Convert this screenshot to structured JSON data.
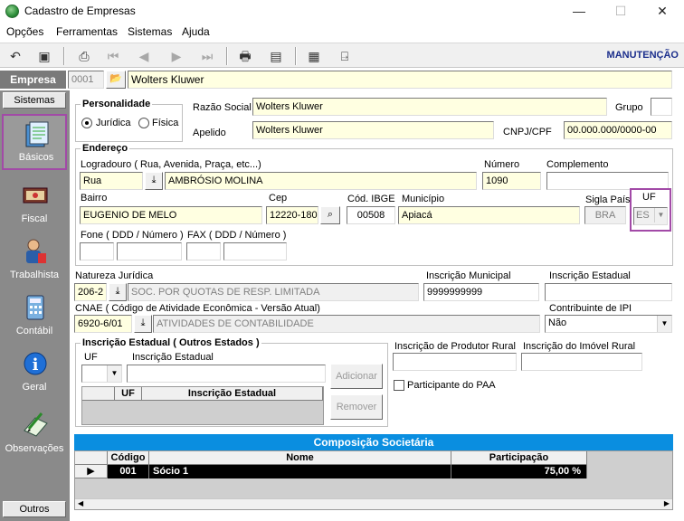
{
  "window": {
    "title": "Cadastro de Empresas",
    "minimize": "—",
    "maximize": "☐",
    "close": "✕"
  },
  "menu": [
    "Opções",
    "Ferramentas",
    "Sistemas",
    "Ajuda"
  ],
  "toolbar": {
    "mode": "MANUTENÇÃO"
  },
  "empresa": {
    "label": "Empresa",
    "code": "0001",
    "name": "Wolters Kluwer"
  },
  "sidebar": {
    "top_label": "Sistemas",
    "bottom_label": "Outros",
    "items": [
      {
        "label": "Básicos",
        "icon": "basicos-icon"
      },
      {
        "label": "Fiscal",
        "icon": "fiscal-icon"
      },
      {
        "label": "Trabalhista",
        "icon": "trabalhista-icon"
      },
      {
        "label": "Contábil",
        "icon": "contabil-icon"
      },
      {
        "label": "Geral",
        "icon": "geral-icon"
      },
      {
        "label": "Observações",
        "icon": "observacoes-icon"
      }
    ]
  },
  "personalidade": {
    "title": "Personalidade",
    "juridica": "Jurídica",
    "fisica": "Física",
    "selected": "Jurídica"
  },
  "razao_social": {
    "label": "Razão Social",
    "value": "Wolters Kluwer"
  },
  "apelido": {
    "label": "Apelido",
    "value": "Wolters Kluwer"
  },
  "grupo": {
    "label": "Grupo",
    "value": ""
  },
  "cnpj": {
    "label": "CNPJ/CPF",
    "value": "00.000.000/0000-00"
  },
  "endereco": {
    "title": "Endereço",
    "logradouro_label": "Logradouro ( Rua, Avenida, Praça, etc...)",
    "tipo": "Rua",
    "logradouro": "AMBRÓSIO MOLINA",
    "numero_label": "Número",
    "numero": "1090",
    "complemento_label": "Complemento",
    "complemento": "",
    "bairro_label": "Bairro",
    "bairro": "EUGENIO DE MELO",
    "cep_label": "Cep",
    "cep": "12220-180",
    "ibge_label": "Cód. IBGE",
    "ibge": "00508",
    "municipio_label": "Município",
    "municipio": "Apiacá",
    "sigla_pais_label": "Sigla País",
    "sigla_pais": "BRA",
    "uf_label": "UF",
    "uf": "ES",
    "fone_label": "Fone ( DDD / Número )",
    "fax_label": "FAX ( DDD / Número )"
  },
  "natureza": {
    "label": "Natureza Jurídica",
    "code": "206-2",
    "desc": "SOC. POR QUOTAS DE RESP. LIMITADA"
  },
  "insc_municipal": {
    "label": "Inscrição Municipal",
    "value": "9999999999"
  },
  "insc_estadual": {
    "label": "Inscrição Estadual",
    "value": ""
  },
  "cnae": {
    "label": "CNAE ( Código de Atividade Econômica - Versão Atual)",
    "code": "6920-6/01",
    "desc": "ATIVIDADES DE CONTABILIDADE"
  },
  "contribuinte_ipi": {
    "label": "Contribuinte de IPI",
    "value": "Não"
  },
  "ie_outros": {
    "title": "Inscrição Estadual ( Outros Estados )",
    "uf_label": "UF",
    "ie_label": "Inscrição Estadual",
    "adicionar": "Adicionar",
    "remover": "Remover",
    "col_uf": "UF",
    "col_ie": "Inscrição Estadual"
  },
  "insc_produtor": {
    "label": "Inscrição de Produtor Rural",
    "value": ""
  },
  "insc_imovel": {
    "label": "Inscrição do Imóvel Rural",
    "value": ""
  },
  "paa": {
    "label": "Participante do PAA",
    "checked": false
  },
  "composicao": {
    "title": "Composição Societária",
    "columns": [
      "Código",
      "Nome",
      "Participação"
    ],
    "rows": [
      {
        "codigo": "001",
        "nome": "Sócio 1",
        "participacao": "75,00 %"
      }
    ]
  }
}
